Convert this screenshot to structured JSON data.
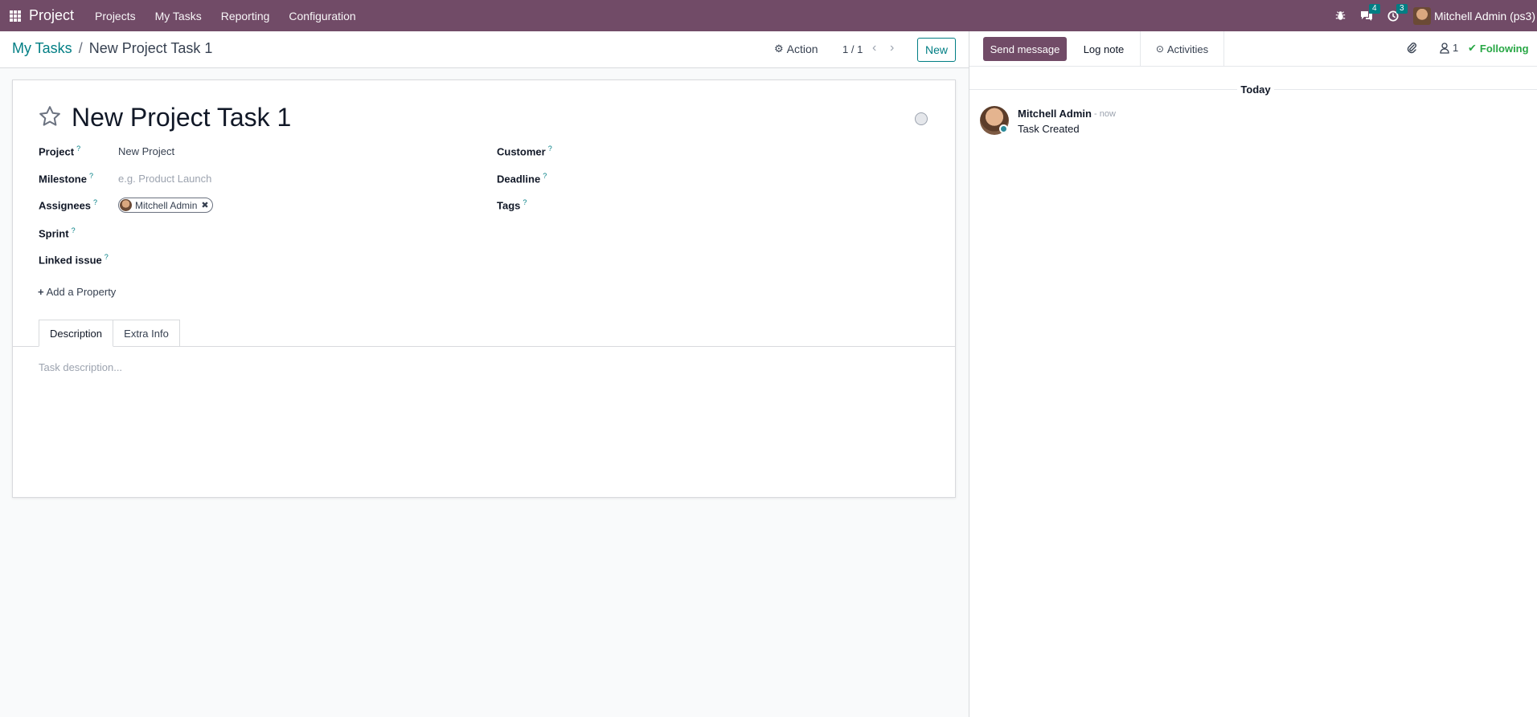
{
  "navbar": {
    "app_name": "Project",
    "menu": [
      "Projects",
      "My Tasks",
      "Reporting",
      "Configuration"
    ],
    "messages_count": "4",
    "activities_count": "3",
    "user_name": "Mitchell Admin (ps3)"
  },
  "control_panel": {
    "breadcrumb_parent": "My Tasks",
    "breadcrumb_separator": "/",
    "breadcrumb_current": "New Project Task 1",
    "action_label": "Action",
    "pager": "1 / 1",
    "new_label": "New"
  },
  "form": {
    "title": "New Project Task 1",
    "fields": {
      "project_label": "Project",
      "project_value": "New Project",
      "milestone_label": "Milestone",
      "milestone_placeholder": "e.g. Product Launch",
      "assignees_label": "Assignees",
      "assignee_name": "Mitchell Admin",
      "sprint_label": "Sprint",
      "linked_issue_label": "Linked issue",
      "customer_label": "Customer",
      "deadline_label": "Deadline",
      "tags_label": "Tags",
      "help_marker": "?"
    },
    "add_property": "Add a Property",
    "tabs": [
      "Description",
      "Extra Info"
    ],
    "description_placeholder": "Task description..."
  },
  "chatter": {
    "send_message": "Send message",
    "log_note": "Log note",
    "activities": "Activities",
    "followers_count": "1",
    "following": "Following",
    "day_label": "Today",
    "message": {
      "author": "Mitchell Admin",
      "time": "- now",
      "body": "Task Created"
    }
  },
  "colors": {
    "brand": "#714b67",
    "accent": "#017e84",
    "following": "#28a745"
  }
}
